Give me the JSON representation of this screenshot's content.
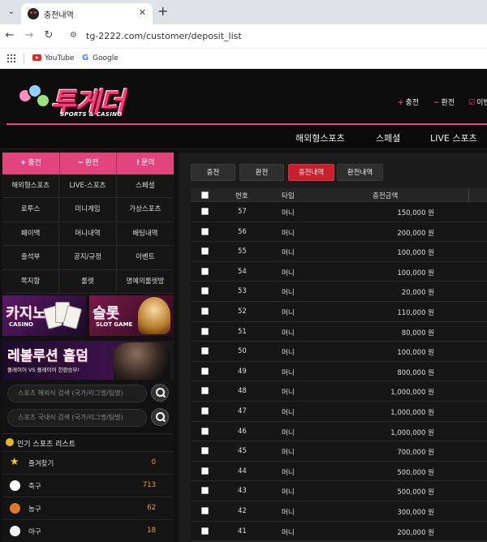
{
  "browser": {
    "tab_title": "충전내역",
    "url": "tg-2222.com/customer/deposit_list",
    "bookmarks": [
      "YouTube",
      "Google"
    ]
  },
  "site": {
    "logo_title": "투게더",
    "logo_sub": "SPORTS & CASINO",
    "header_links": [
      {
        "icon": "+",
        "label": "충전"
      },
      {
        "icon": "−",
        "label": "환전"
      },
      {
        "icon": "☑",
        "label": "이벤"
      }
    ],
    "top_nav": [
      "해외형스포츠",
      "스페셜",
      "LIVE 스포츠"
    ],
    "sidebar": {
      "top_buttons": [
        {
          "icon": "+",
          "label": "충전"
        },
        {
          "icon": "−",
          "label": "환전"
        },
        {
          "icon": "!",
          "label": "문의"
        }
      ],
      "menu": [
        "해외형스포츠",
        "LIVE-스포츠",
        "스페셜",
        "로투스",
        "미니게임",
        "가상스포츠",
        "페이백",
        "머니내역",
        "배팅내역",
        "출석부",
        "공지/규정",
        "이벤트",
        "쪽지함",
        "룰렛",
        "명예의룰렛방"
      ],
      "banner_casino_title": "카지노",
      "banner_casino_sub": "CASINO",
      "banner_slot_title": "슬롯",
      "banner_slot_sub": "SLOT GAME",
      "banner_wide_title": "레볼루션 홀덤",
      "banner_wide_sub": "플레이어 VS 플레이어 한판승부!",
      "search_overseas_placeholder": "스포츠 해외식 검색 (국가/리그명/팀명)",
      "search_domestic_placeholder": "스포츠 국내식 검색 (국가/리그명/팀명)",
      "popular_title": "인기 스포츠 리스트",
      "sports": [
        {
          "name": "즐겨찾기",
          "count": "0",
          "icon": "star-icon",
          "color": "#f5c518"
        },
        {
          "name": "축구",
          "count": "713",
          "icon": "soccer-ball-icon",
          "color": "#ffffff"
        },
        {
          "name": "농구",
          "count": "62",
          "icon": "basketball-icon",
          "color": "#e0782a"
        },
        {
          "name": "야구",
          "count": "18",
          "icon": "baseball-icon",
          "color": "#f2f2f2"
        }
      ]
    },
    "main": {
      "tabs": [
        "충전",
        "환전",
        "충전내역",
        "환전내역"
      ],
      "active_tab": "충전내역",
      "table_headers": [
        "번호",
        "타입",
        "충전금액"
      ],
      "rows": [
        {
          "no": "57",
          "type": "머니",
          "amount": "150,000 원"
        },
        {
          "no": "56",
          "type": "머니",
          "amount": "200,000 원"
        },
        {
          "no": "55",
          "type": "머니",
          "amount": "100,000 원"
        },
        {
          "no": "54",
          "type": "머니",
          "amount": "100,000 원"
        },
        {
          "no": "53",
          "type": "머니",
          "amount": "20,000 원"
        },
        {
          "no": "52",
          "type": "머니",
          "amount": "110,000 원"
        },
        {
          "no": "51",
          "type": "머니",
          "amount": "80,000 원"
        },
        {
          "no": "50",
          "type": "머니",
          "amount": "100,000 원"
        },
        {
          "no": "49",
          "type": "머니",
          "amount": "800,000 원"
        },
        {
          "no": "48",
          "type": "머니",
          "amount": "1,000,000 원"
        },
        {
          "no": "47",
          "type": "머니",
          "amount": "1,000,000 원"
        },
        {
          "no": "46",
          "type": "머니",
          "amount": "1,000,000 원"
        },
        {
          "no": "45",
          "type": "머니",
          "amount": "700,000 원"
        },
        {
          "no": "44",
          "type": "머니",
          "amount": "500,000 원"
        },
        {
          "no": "43",
          "type": "머니",
          "amount": "500,000 원"
        },
        {
          "no": "42",
          "type": "머니",
          "amount": "300,000 원"
        },
        {
          "no": "41",
          "type": "머니",
          "amount": "200,000 원"
        }
      ]
    }
  }
}
